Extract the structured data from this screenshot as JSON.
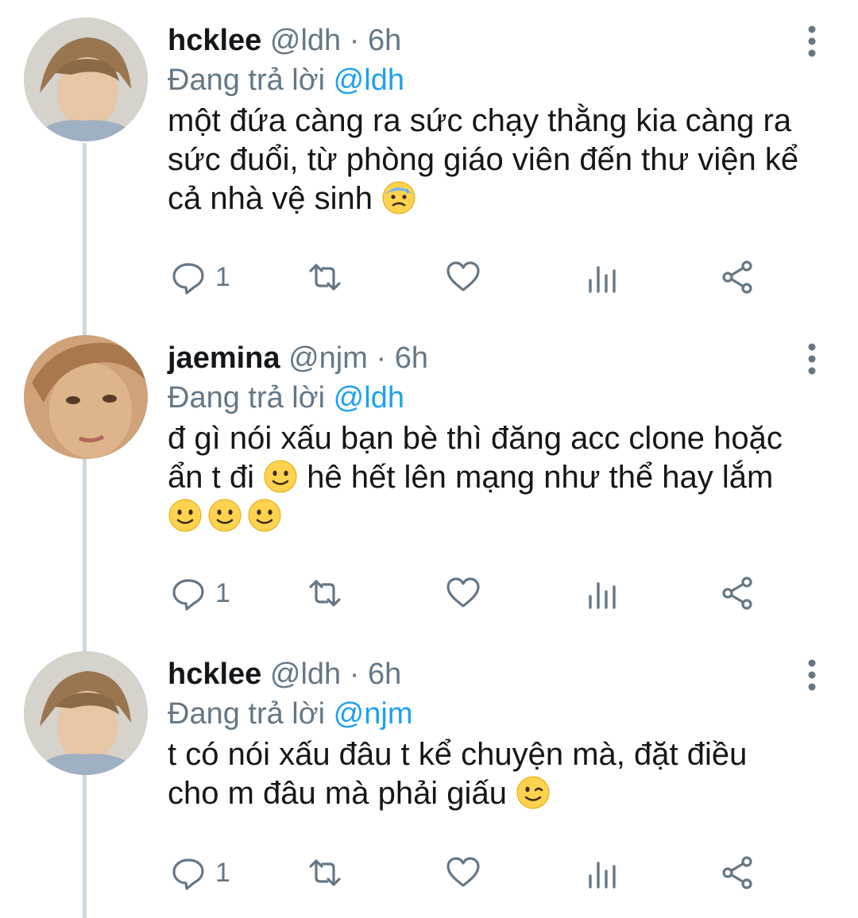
{
  "tweets": [
    {
      "name": "hcklee",
      "handle": "@ldh",
      "separator": "·",
      "time": "6h",
      "replying_prefix": "Đang trả lời",
      "replying_to": "@ldh",
      "lines": [
        {
          "text": "một đứa càng ra sức chạy thằng kia càng ra",
          "emojis": []
        },
        {
          "text": "sức đuổi, từ phòng giáo viên đến thư viện kể",
          "emojis": []
        },
        {
          "text": "cả nhà vệ sinh",
          "emojis": [
            "anxious-sweat-face"
          ]
        }
      ],
      "reply_count": "1"
    },
    {
      "name": "jaemina",
      "handle": "@njm",
      "separator": "·",
      "time": "6h",
      "replying_prefix": "Đang trả lời",
      "replying_to": "@ldh",
      "lines": [
        {
          "text": "đ gì nói xấu bạn bè thì đăng acc clone hoặc",
          "emojis": []
        },
        {
          "text_before": "ẩn t đi",
          "emojis_mid": [
            "slight-smile-face"
          ],
          "text_after": "hê hết lên mạng như thể hay lắm"
        },
        {
          "text": "",
          "emojis": [
            "slight-smile-face",
            "slight-smile-face",
            "slight-smile-face"
          ]
        }
      ],
      "reply_count": "1"
    },
    {
      "name": "hcklee",
      "handle": "@ldh",
      "separator": "·",
      "time": "6h",
      "replying_prefix": "Đang trả lời",
      "replying_to": "@njm",
      "lines": [
        {
          "text": "t có nói xấu đâu t kể chuyện mà, đặt điều",
          "emojis": []
        },
        {
          "text": "cho m đâu mà phải giấu",
          "emojis": [
            "wink-face"
          ]
        }
      ],
      "reply_count": "1"
    }
  ],
  "icons": {
    "reply": "reply-icon",
    "retweet": "retweet-icon",
    "like": "heart-icon",
    "views": "analytics-icon",
    "share": "share-icon",
    "more": "more-vertical-icon"
  },
  "colors": {
    "text": "#14171a",
    "muted": "#657786",
    "link": "#1da1f2",
    "thread_line": "#cfd9de"
  }
}
